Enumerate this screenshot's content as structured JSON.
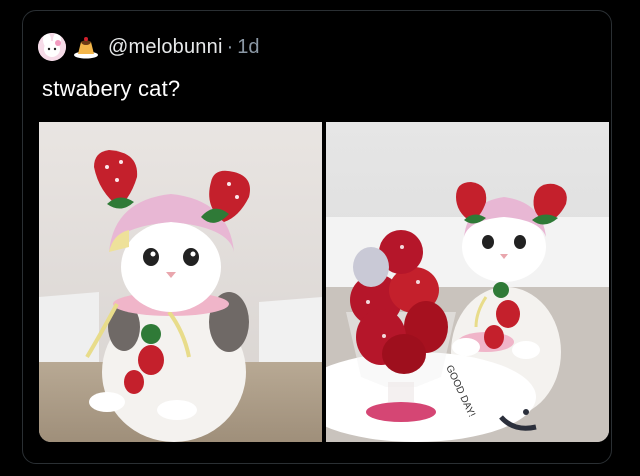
{
  "tweet": {
    "handle": "@melobunni",
    "separator": "·",
    "time": "1d",
    "text": "stwabery cat?"
  },
  "media": {
    "images": [
      {
        "name": "cat-strawberry-hat-photo-1",
        "sign_text": ""
      },
      {
        "name": "cat-strawberry-hat-photo-2",
        "sign_text": "GOOD DAY!"
      }
    ]
  },
  "colors": {
    "background": "#000000",
    "text_primary": "#ffffff",
    "text_secondary": "#8b98a5",
    "strawberry_red": "#c4202c",
    "hat_pink": "#e8b7d4",
    "leaf_green": "#2f7a37"
  },
  "icons": {
    "avatar": "my-melody-avatar-icon",
    "emoji": "flan-pudding-icon"
  }
}
